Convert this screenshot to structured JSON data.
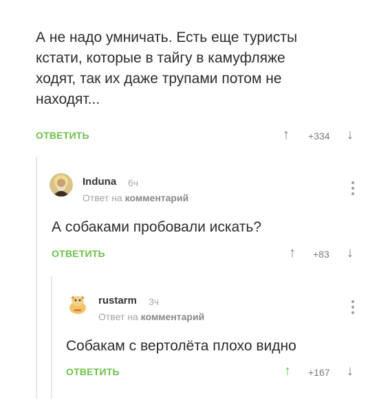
{
  "colors": {
    "accent": "#6cc04a",
    "muted": "#7a7a7a",
    "thread_line": "#e6e6e6"
  },
  "comments": [
    {
      "text_lines": [
        "А не надо умничать. Есть еще туристы",
        "кстати, которые в тайгу в камуфляже",
        "ходят, так их даже трупами потом не",
        "находят..."
      ],
      "reply_label": "ОТВЕТИТЬ",
      "votes": "+334"
    },
    {
      "username": "Induna",
      "time": "6ч",
      "reply_prefix": "Ответ на",
      "reply_target": "комментарий",
      "text": "А собаками пробовали искать?",
      "reply_label": "ОТВЕТИТЬ",
      "votes": "+83",
      "avatar_icon": "saint-portrait-icon"
    },
    {
      "username": "rustarm",
      "time": "3ч",
      "reply_prefix": "Ответ на",
      "reply_target": "комментарий",
      "text": "Собакам с вертолёта плохо видно",
      "reply_label": "ОТВЕТИТЬ",
      "votes": "+167",
      "avatar_icon": "dog-cartoon-icon"
    }
  ],
  "icons": {
    "upvote": "↑",
    "downvote": "↓"
  }
}
